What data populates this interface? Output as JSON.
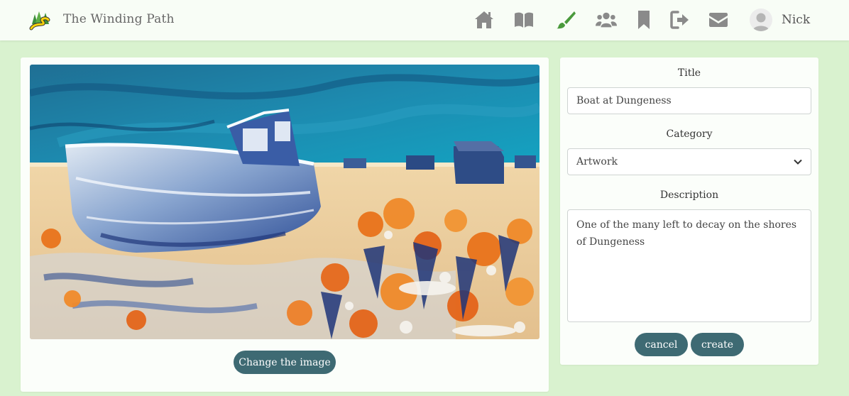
{
  "brand": {
    "name": "The Winding Path",
    "logo_icon": "winding-path-logo-icon"
  },
  "nav": {
    "icons": [
      "home-icon",
      "book-icon",
      "paintbrush-icon",
      "users-icon",
      "bookmark-icon",
      "sign-out-icon",
      "envelope-icon"
    ],
    "active": "paintbrush-icon",
    "active_color": "#4a9a3c",
    "icon_color": "#8a8a8a",
    "user_name": "Nick"
  },
  "image_panel": {
    "change_image_label": "Change the image"
  },
  "form": {
    "title_label": "Title",
    "title_value": "Boat at Dungeness",
    "category_label": "Category",
    "category_value": "Artwork",
    "description_label": "Description",
    "description_value": "One of the many left to decay on the shores of Dungeness",
    "cancel_label": "cancel",
    "create_label": "create"
  },
  "colors": {
    "background": "#d9f2cf",
    "button": "#3e6a73",
    "panel": "#fbfefa"
  }
}
